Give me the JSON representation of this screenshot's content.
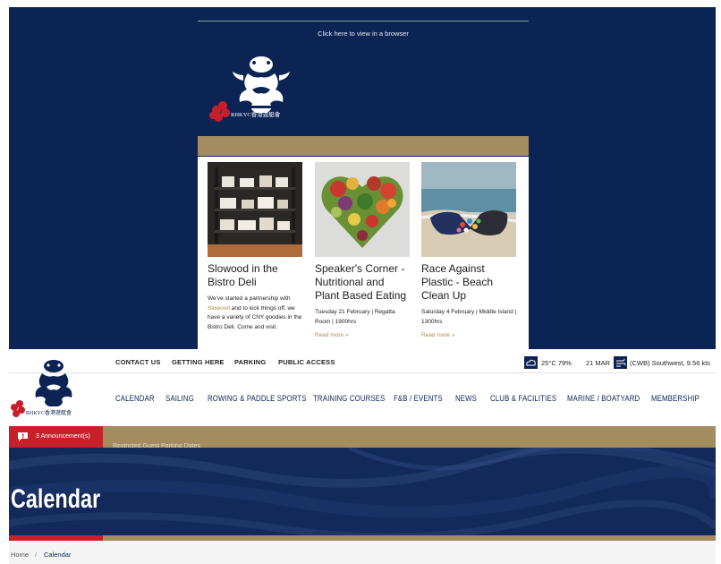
{
  "email": {
    "view_in_browser": "Click here to view in a browser",
    "logo_text": "RHKYC香港遊艇會",
    "articles": [
      {
        "title": "Slowood in the Bistro Deli",
        "body_prefix": "We've started a partnership with ",
        "body_link": "Slowood",
        "body_suffix": " and to kick things off, we have a variety of CNY goodies in the Bistro Deli. Come and visit."
      },
      {
        "title": "Speaker's Corner - Nutritional and Plant Based Eating",
        "body": "Tuesday 21 February | Regatta Room | 1900hrs",
        "more": "Read more »"
      },
      {
        "title": "Race Against Plastic - Beach Clean Up",
        "body": "Saturday 4 February | Middle Island | 1300hrs",
        "more": "Read more »"
      }
    ]
  },
  "site": {
    "logo_text": "RHKYC香港遊艇會",
    "top_links": [
      "CONTACT US",
      "GETTING HERE",
      "PARKING",
      "PUBLIC ACCESS"
    ],
    "weather": {
      "temp_humidity": "25°C 79%",
      "date": "21 MAR",
      "wind": "(CWB) Southwest, 9.56 kts"
    },
    "nav": [
      "CALENDAR",
      "SAILING",
      "ROWING & PADDLE SPORTS",
      "TRAINING COURSES",
      "F&B / EVENTS",
      "NEWS",
      "CLUB & FACILITIES",
      "MARINE / BOATYARD",
      "MEMBERSHIP"
    ],
    "announcements": {
      "label": "3 Announcement(s)",
      "message": "Restricted Guest Parking Dates"
    },
    "hero_title": "Calendar",
    "breadcrumb": {
      "home": "Home",
      "separator": "/",
      "current": "Calendar"
    }
  },
  "colors": {
    "navy": "#0b2454",
    "gold": "#a38c5f",
    "red": "#c8202b"
  }
}
